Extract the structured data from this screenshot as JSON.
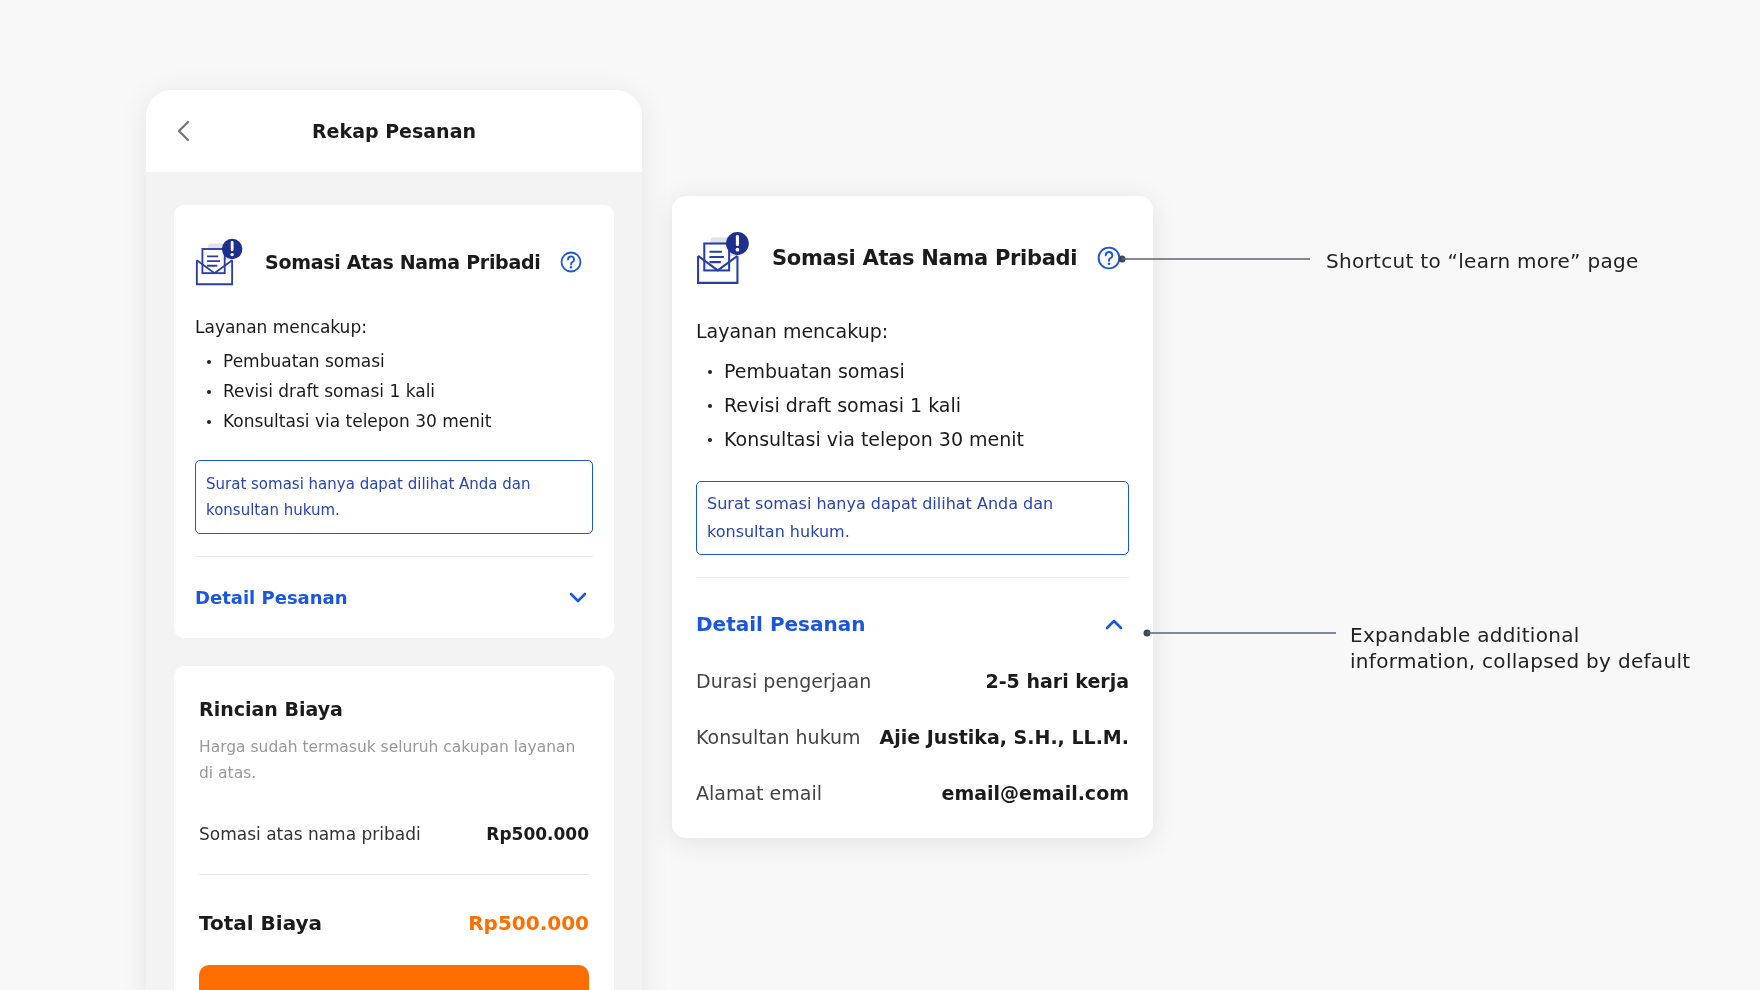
{
  "screen": {
    "title": "Rekap Pesanan",
    "service_card": {
      "title": "Somasi Atas Nama Pribadi",
      "includes_label": "Layanan mencakup:",
      "items": [
        "Pembuatan somasi",
        "Revisi draft somasi 1 kali",
        "Konsultasi via telepon 30 menit"
      ],
      "notice": "Surat somasi hanya dapat dilihat Anda dan konsultan hukum.",
      "details": {
        "label": "Detail Pesanan",
        "expanded": false
      }
    },
    "cost_card": {
      "title": "Rincian Biaya",
      "hint": "Harga sudah termasuk seluruh cakupan layanan di atas.",
      "rows": [
        {
          "label": "Somasi atas nama pribadi",
          "value": "Rp500.000"
        }
      ],
      "total_label": "Total Biaya",
      "total_value": "Rp500.000"
    }
  },
  "detail_card": {
    "title": "Somasi Atas Nama Pribadi",
    "includes_label": "Layanan mencakup:",
    "items": [
      "Pembuatan somasi",
      "Revisi draft somasi 1 kali",
      "Konsultasi via telepon 30 menit"
    ],
    "notice": "Surat somasi hanya dapat dilihat Anda dan konsultan hukum.",
    "details": {
      "label": "Detail Pesanan",
      "expanded": true,
      "rows": [
        {
          "label": "Durasi pengerjaan",
          "value": "2-5 hari kerja"
        },
        {
          "label": "Konsultan hukum",
          "value": "Ajie Justika, S.H., LL.M."
        },
        {
          "label": "Alamat email",
          "value": "email@email.com"
        }
      ]
    }
  },
  "annotations": [
    {
      "kind": "help",
      "text": "Shortcut to “learn more” page"
    },
    {
      "kind": "details",
      "text": "Expandable additional information, collapsed by default"
    }
  ]
}
